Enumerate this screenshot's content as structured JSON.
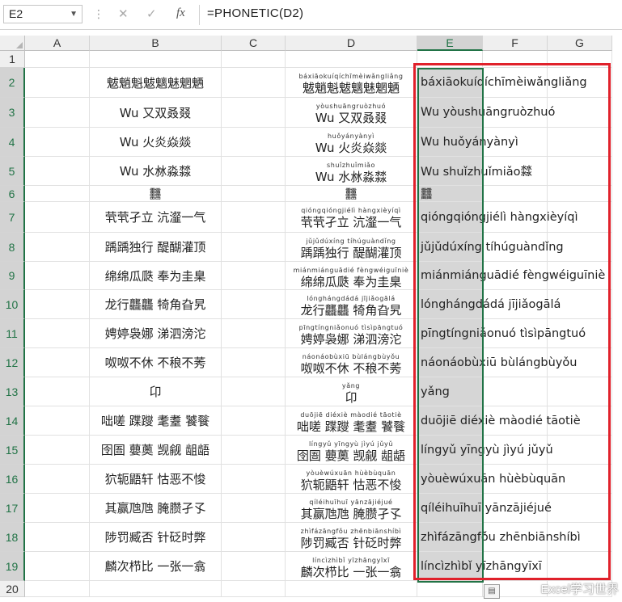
{
  "name_box": "E2",
  "formula": "=PHONETIC(D2)",
  "formula_bar_icons": [
    "cancel-icon",
    "enter-icon",
    "function-icon"
  ],
  "function_label": "fx",
  "columns": [
    "A",
    "B",
    "C",
    "D",
    "E",
    "F",
    "G"
  ],
  "rows": [
    {
      "num": "1",
      "b": "",
      "d_py": "",
      "d_hz": "",
      "e": ""
    },
    {
      "num": "2",
      "b": "魃魈魁魃魑魅魍魉",
      "d_py": "báxiāokuíqíchīmèiwǎngliǎng",
      "d_hz": "魃魈魁魃魑魅魍魉",
      "e": "báxiāokuíqíchīmèiwǎngliǎng"
    },
    {
      "num": "3",
      "b": "Wu 又双叒叕",
      "d_py": "yòushuāngruòzhuó",
      "d_hz": "Wu 又双叒叕",
      "e": "Wu yòushuāngruòzhuó"
    },
    {
      "num": "4",
      "b": "Wu 火炎焱燚",
      "d_py": "huǒyányànyì",
      "d_hz": "Wu 火炎焱燚",
      "e": "Wu huǒyányànyì"
    },
    {
      "num": "5",
      "b": "Wu 水沝淼㵘",
      "d_py": "shuǐzhuǐmiǎo",
      "d_hz": "Wu 水沝淼㵘",
      "e": "Wu shuǐzhuǐmiǎo㵘"
    },
    {
      "num": "6",
      "b": "䨻",
      "d_py": "",
      "d_hz": "䨻",
      "e": "䨻"
    },
    {
      "num": "7",
      "b": "茕茕孑立 沆瀣一气",
      "d_py": "qióngqióngjiélì hàngxièyíqì",
      "d_hz": "茕茕孑立 沆瀣一气",
      "e": "qióngqióngjiélì hàngxièyíqì"
    },
    {
      "num": "8",
      "b": "踽踽独行 醍醐灌顶",
      "d_py": "jǔjǔdúxíng tíhúguàndǐng",
      "d_hz": "踽踽独行 醍醐灌顶",
      "e": "jǔjǔdúxíng tíhúguàndǐng"
    },
    {
      "num": "9",
      "b": "绵绵瓜瓞 奉为圭臬",
      "d_py": "miánmiánguādié fèngwéiguīniè",
      "d_hz": "绵绵瓜瓞 奉为圭臬",
      "e": "miánmiánguādié fèngwéiguīniè"
    },
    {
      "num": "10",
      "b": "龙行龘龘 犄角旮旯",
      "d_py": "lónghángdádá jījiǎogālá",
      "d_hz": "龙行龘龘 犄角旮旯",
      "e": "lónghángdádá jījiǎogālá"
    },
    {
      "num": "11",
      "b": "娉婷袅娜 涕泗滂沱",
      "d_py": "pīngtíngniǎonuó tìsìpāngtuó",
      "d_hz": "娉婷袅娜 涕泗滂沱",
      "e": "pīngtíngniǎonuó tìsìpāngtuó"
    },
    {
      "num": "12",
      "b": "呶呶不休 不稂不莠",
      "d_py": "náonáobùxiū bùlángbùyǒu",
      "d_hz": "呶呶不休 不稂不莠",
      "e": "náonáobùxiū bùlángbùyǒu"
    },
    {
      "num": "13",
      "b": "卬",
      "d_py": "yǎng",
      "d_hz": "卬",
      "e": "yǎng"
    },
    {
      "num": "14",
      "b": "咄嗟 蹀躞 耄耋 饕餮",
      "d_py": "duōjiē diéxiè màodié tāotiè",
      "d_hz": "咄嗟 蹀躞 耄耋 饕餮",
      "e": "duōjiē diéxiè màodié tāotiè"
    },
    {
      "num": "15",
      "b": "囹圄 蘡薁 觊觎 龃龉",
      "d_py": "língyǔ yīngyù jìyú jǔyǔ",
      "d_hz": "囹圄 蘡薁 觊觎 龃龉",
      "e": "língyǔ yīngyù jìyú jǔyǔ"
    },
    {
      "num": "16",
      "b": "狖轭鼯轩 怙恶不悛",
      "d_py": "yòuèwúxuān hùèbùquān",
      "d_hz": "狖轭鼯轩 怙恶不悛",
      "e": "yòuèwúxuān hùèbùquān"
    },
    {
      "num": "17",
      "b": "其赢虺虺 腌臜孑孓",
      "d_py": "qíléihuīhuī yānzājiéjué",
      "d_hz": "其赢虺虺 腌臜孑孓",
      "e": "qíléihuīhuī yānzājiéjué"
    },
    {
      "num": "18",
      "b": "陟罚臧否 针砭时弊",
      "d_py": "zhìfázāngfǒu zhēnbiānshíbì",
      "d_hz": "陟罚臧否 针砭时弊",
      "e": "zhìfázāngfǒu zhēnbiānshíbì"
    },
    {
      "num": "19",
      "b": "麟次栉比 一张一翕",
      "d_py": "líncìzhìbǐ yīzhāngyīxī",
      "d_hz": "麟次栉比 一张一翕",
      "e": "líncìzhìbǐ yīzhāngyīxī"
    },
    {
      "num": "20",
      "b": "",
      "d_py": "",
      "d_hz": "",
      "e": ""
    }
  ],
  "watermark": "Excel学习世界",
  "colors": {
    "selection": "#217346",
    "highlight_border": "#e0212b",
    "selected_fill": "#d6d6d6"
  }
}
